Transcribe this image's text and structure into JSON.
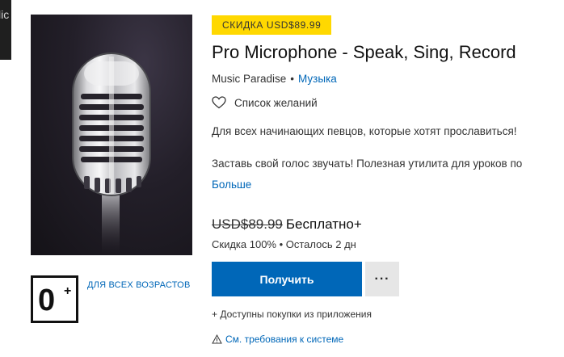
{
  "window_sliver": {
    "text": "lic"
  },
  "product": {
    "image_icon": "microphone-icon",
    "discount_badge": "СКИДКА USD$89.99",
    "title": "Pro Microphone - Speak, Sing, Record",
    "publisher": "Music Paradise",
    "separator": "•",
    "category": "Музыка",
    "wishlist_label": "Список желаний",
    "description_line1": "Для всех начинающих певцов, которые хотят прославиться!",
    "description_line2": "Заставь свой голос звучать! Полезная утилита для уроков по",
    "more_link": "Больше",
    "price_old": "USD$89.99",
    "price_new": "Бесплатно+",
    "discount_info": "Скидка 100% • Осталось 2 дн",
    "get_button": "Получить",
    "more_button": "···",
    "iap_note": "+ Доступны покупки из приложения",
    "sysreq_link": "См. требования к системе"
  },
  "age_rating": {
    "value": "0",
    "plus": "+",
    "label": "ДЛЯ ВСЕХ ВОЗРАСТОВ"
  },
  "colors": {
    "accent": "#0067b8",
    "badge": "#ffd800",
    "secondary_button": "#e6e6e6"
  }
}
